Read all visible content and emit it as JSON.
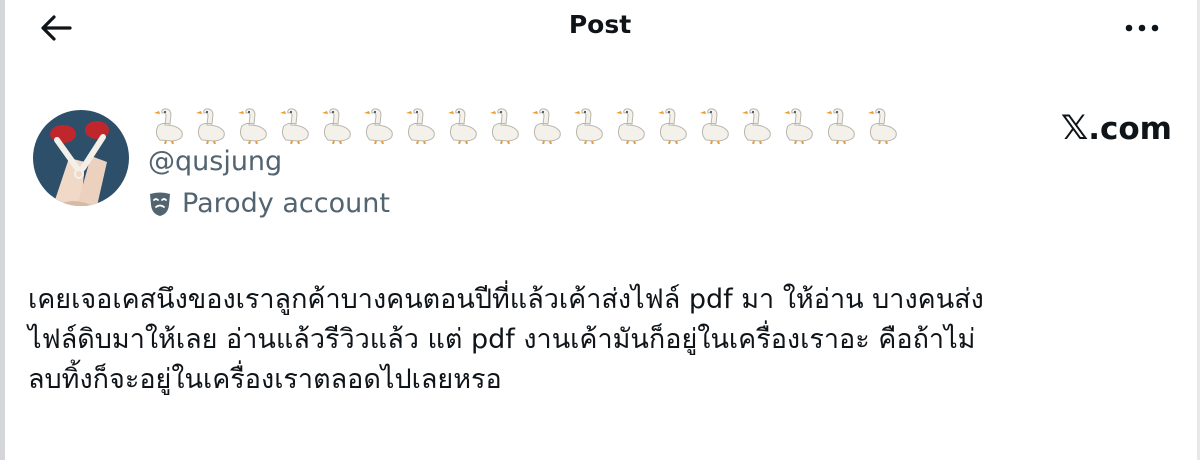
{
  "header": {
    "title": "Post"
  },
  "author": {
    "display_name_emoji_count": 18,
    "handle": "@qusjung",
    "badge_label": "Parody account"
  },
  "watermark": {
    "x_char": "𝕏",
    "suffix": ".com"
  },
  "post": {
    "lines": [
      "เคยเจอเคสนึงของเราลูกค้าบางคนตอนปีที่แล้วเค้าส่งไฟล์ pdf มา ให้อ่าน บางคนส่ง",
      "ไฟล์ดิบมาให้เลย อ่านแล้วรีวิวแล้ว แต่ pdf งานเค้ามันก็อยู่ในเครื่องเราอะ คือถ้าไม่",
      "ลบทิ้งก็จะอยู่ในเครื่องเราตลอดไปเลยหรอ"
    ]
  },
  "colors": {
    "text": "#0f1419",
    "secondary": "#536471",
    "avatar_bg": "#2d4f6a",
    "shoe": "#c0272d"
  }
}
